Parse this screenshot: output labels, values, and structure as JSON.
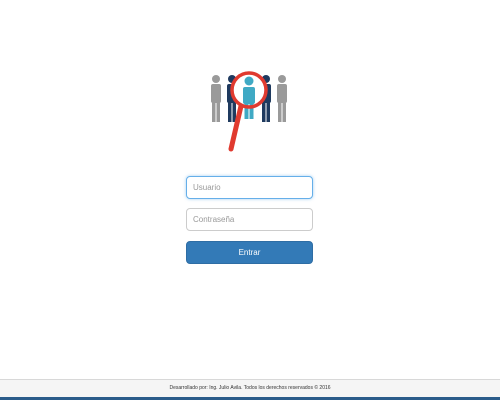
{
  "login": {
    "logo_icon": "people-search-icon",
    "username_placeholder": "Usuario",
    "password_placeholder": "Contraseña",
    "submit_label": "Entrar"
  },
  "footer": {
    "text": "Desarrollado por: Ing. Julio Avila. Todos los derechos reservados © 2016"
  },
  "colors": {
    "primary": "#337ab7",
    "focus_border": "#66afe9",
    "magnifier": "#e03a2f",
    "person_teal": "#3fa9c4",
    "person_navy": "#1f3a5f",
    "person_gray": "#9a9a9a",
    "footer_bar": "#2b5c8a"
  }
}
